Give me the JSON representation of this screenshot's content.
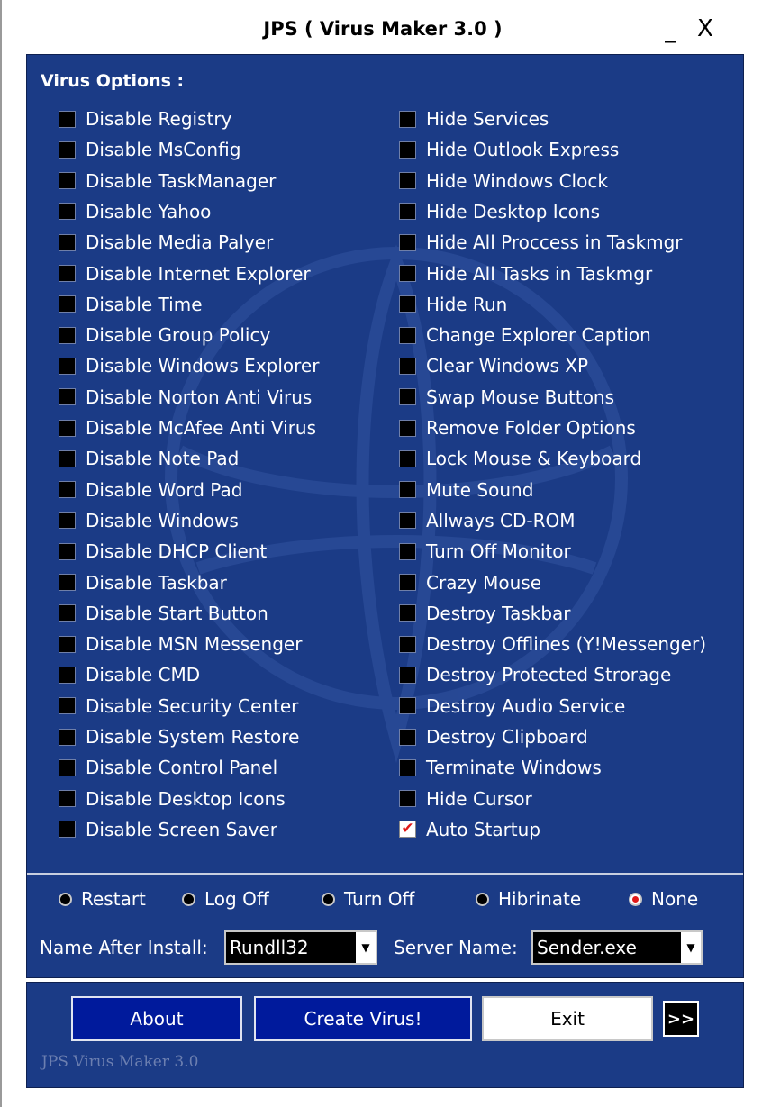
{
  "window": {
    "title": "JPS ( Virus Maker 3.0 )",
    "minimize": "_",
    "close": "X"
  },
  "options_title": "Virus Options :",
  "left_options": [
    {
      "label": "Disable Registry",
      "checked": false
    },
    {
      "label": "Disable MsConfig",
      "checked": false
    },
    {
      "label": "Disable TaskManager",
      "checked": false
    },
    {
      "label": "Disable Yahoo",
      "checked": false
    },
    {
      "label": "Disable Media Palyer",
      "checked": false
    },
    {
      "label": "Disable Internet Explorer",
      "checked": false
    },
    {
      "label": "Disable Time",
      "checked": false
    },
    {
      "label": "Disable Group Policy",
      "checked": false
    },
    {
      "label": "Disable Windows Explorer",
      "checked": false
    },
    {
      "label": "Disable Norton Anti Virus",
      "checked": false
    },
    {
      "label": "Disable McAfee Anti Virus",
      "checked": false
    },
    {
      "label": "Disable Note Pad",
      "checked": false
    },
    {
      "label": "Disable Word Pad",
      "checked": false
    },
    {
      "label": "Disable Windows",
      "checked": false
    },
    {
      "label": "Disable DHCP Client",
      "checked": false
    },
    {
      "label": "Disable Taskbar",
      "checked": false
    },
    {
      "label": "Disable Start Button",
      "checked": false
    },
    {
      "label": "Disable MSN Messenger",
      "checked": false
    },
    {
      "label": "Disable CMD",
      "checked": false
    },
    {
      "label": "Disable Security Center",
      "checked": false
    },
    {
      "label": "Disable System Restore",
      "checked": false
    },
    {
      "label": "Disable Control Panel",
      "checked": false
    },
    {
      "label": "Disable Desktop Icons",
      "checked": false
    },
    {
      "label": "Disable Screen Saver",
      "checked": false
    }
  ],
  "right_options": [
    {
      "label": "Hide Services",
      "checked": false
    },
    {
      "label": "Hide Outlook Express",
      "checked": false
    },
    {
      "label": "Hide Windows Clock",
      "checked": false
    },
    {
      "label": "Hide Desktop Icons",
      "checked": false
    },
    {
      "label": "Hide All Proccess in Taskmgr",
      "checked": false
    },
    {
      "label": "Hide All Tasks in Taskmgr",
      "checked": false
    },
    {
      "label": "Hide Run",
      "checked": false
    },
    {
      "label": "Change Explorer Caption",
      "checked": false
    },
    {
      "label": "Clear Windows XP",
      "checked": false
    },
    {
      "label": "Swap Mouse Buttons",
      "checked": false
    },
    {
      "label": "Remove Folder Options",
      "checked": false
    },
    {
      "label": "Lock Mouse & Keyboard",
      "checked": false
    },
    {
      "label": "Mute Sound",
      "checked": false
    },
    {
      "label": "Allways CD-ROM",
      "checked": false
    },
    {
      "label": "Turn Off Monitor",
      "checked": false
    },
    {
      "label": "Crazy Mouse",
      "checked": false
    },
    {
      "label": "Destroy Taskbar",
      "checked": false
    },
    {
      "label": "Destroy Offlines (Y!Messenger)",
      "checked": false
    },
    {
      "label": "Destroy Protected Strorage",
      "checked": false
    },
    {
      "label": "Destroy Audio Service",
      "checked": false
    },
    {
      "label": "Destroy Clipboard",
      "checked": false
    },
    {
      "label": "Terminate Windows",
      "checked": false
    },
    {
      "label": "Hide Cursor",
      "checked": false
    },
    {
      "label": "Auto Startup",
      "checked": true
    }
  ],
  "after_action": {
    "options": [
      "Restart",
      "Log Off",
      "Turn Off",
      "Hibrinate",
      "None"
    ],
    "selected": "None"
  },
  "name_after_install": {
    "label": "Name After Install:",
    "value": "Rundll32"
  },
  "server_name": {
    "label": "Server Name:",
    "value": "Sender.exe"
  },
  "buttons": {
    "about": "About",
    "create": "Create Virus!",
    "exit": "Exit",
    "more": ">>"
  },
  "footer": "JPS Virus Maker 3.0",
  "colors": {
    "panel": "#1b3b86",
    "button": "#001a9c",
    "check": "#e01818"
  }
}
